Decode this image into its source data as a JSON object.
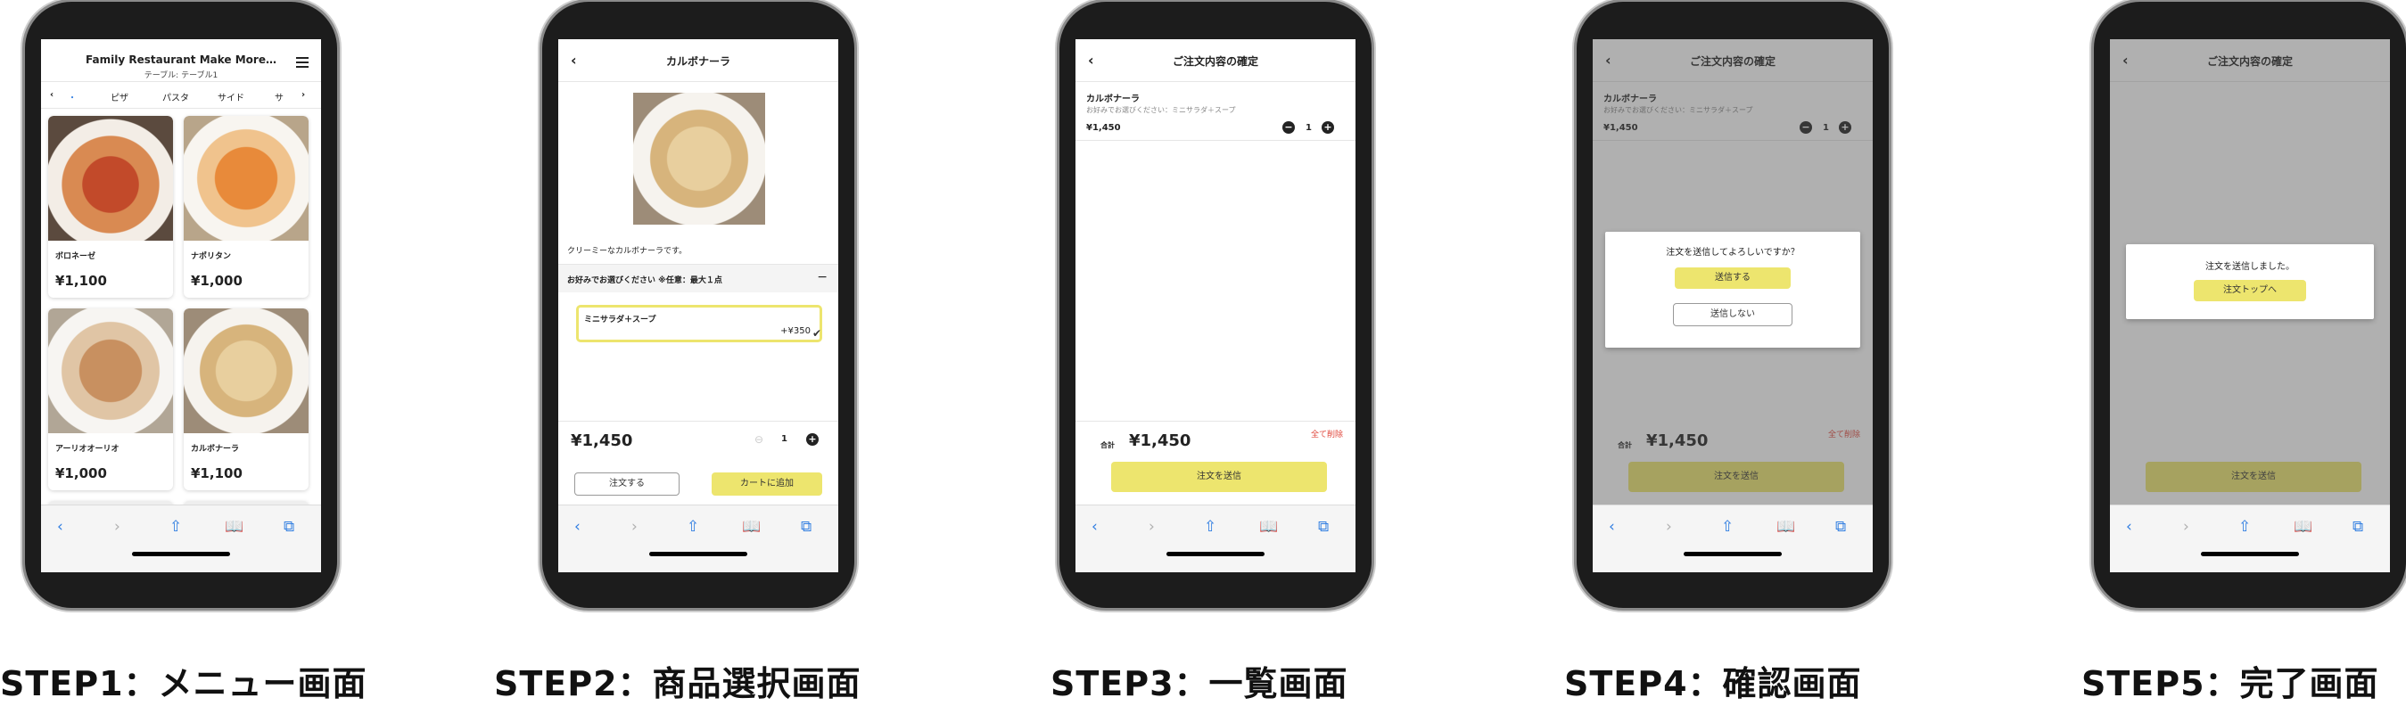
{
  "captions": [
    "STEP1：メニュー画面",
    "STEP2：商品選択画面",
    "STEP3：一覧画面",
    "STEP4：確認画面",
    "STEP5：完了画面"
  ],
  "step1": {
    "title": "Family Restaurant Make More…",
    "subtitle": "テーブル: テーブル1",
    "tabs": [
      "・",
      "ピザ",
      "パスタ",
      "サイド",
      "サ"
    ],
    "items": [
      {
        "name": "ボロネーゼ",
        "price": "¥1,100"
      },
      {
        "name": "ナポリタン",
        "price": "¥1,000"
      },
      {
        "name": "アーリオオーリオ",
        "price": "¥1,000"
      },
      {
        "name": "カルボナーラ",
        "price": "¥1,100"
      }
    ]
  },
  "step2": {
    "title": "カルボナーラ",
    "description": "クリーミーなカルボナーラです。",
    "options_header": "お好みでお選びください ※任意：最大１点",
    "option_name": "ミニサラダ＋スープ",
    "option_price": "+¥350",
    "price": "¥1,450",
    "qty": "1",
    "order_btn": "注文する",
    "cart_btn": "カートに追加"
  },
  "step3": {
    "title": "ご注文内容の確定",
    "item_name": "カルボナーラ",
    "item_option": "お好みでお選びください：ミニサラダ＋スープ",
    "item_price": "¥1,450",
    "qty": "1",
    "delete_all": "全て削除",
    "total_label": "合計",
    "total": "¥1,450",
    "send_btn": "注文を送信"
  },
  "step4": {
    "title": "ご注文内容の確定",
    "item_name": "カルボナーラ",
    "item_option": "お好みでお選びください：ミニサラダ＋スープ",
    "item_price": "¥1,450",
    "qty": "1",
    "delete_all": "全て削除",
    "total_label": "合計",
    "total": "¥1,450",
    "send_btn": "注文を送信",
    "modal_text": "注文を送信してよろしいですか？",
    "confirm_btn": "送信する",
    "cancel_btn": "送信しない"
  },
  "step5": {
    "title": "ご注文内容の確定",
    "modal_text": "注文を送信しました。",
    "top_btn": "注文トップへ",
    "send_btn": "注文を送信"
  },
  "nav_icons": [
    "back-arrow-icon",
    "forward-arrow-icon",
    "share-icon",
    "bookmarks-icon",
    "tabs-icon"
  ],
  "colors": {
    "accent_yellow": "#ede56e",
    "ios_blue": "#2f7de1",
    "delete_red": "#e0473c"
  }
}
